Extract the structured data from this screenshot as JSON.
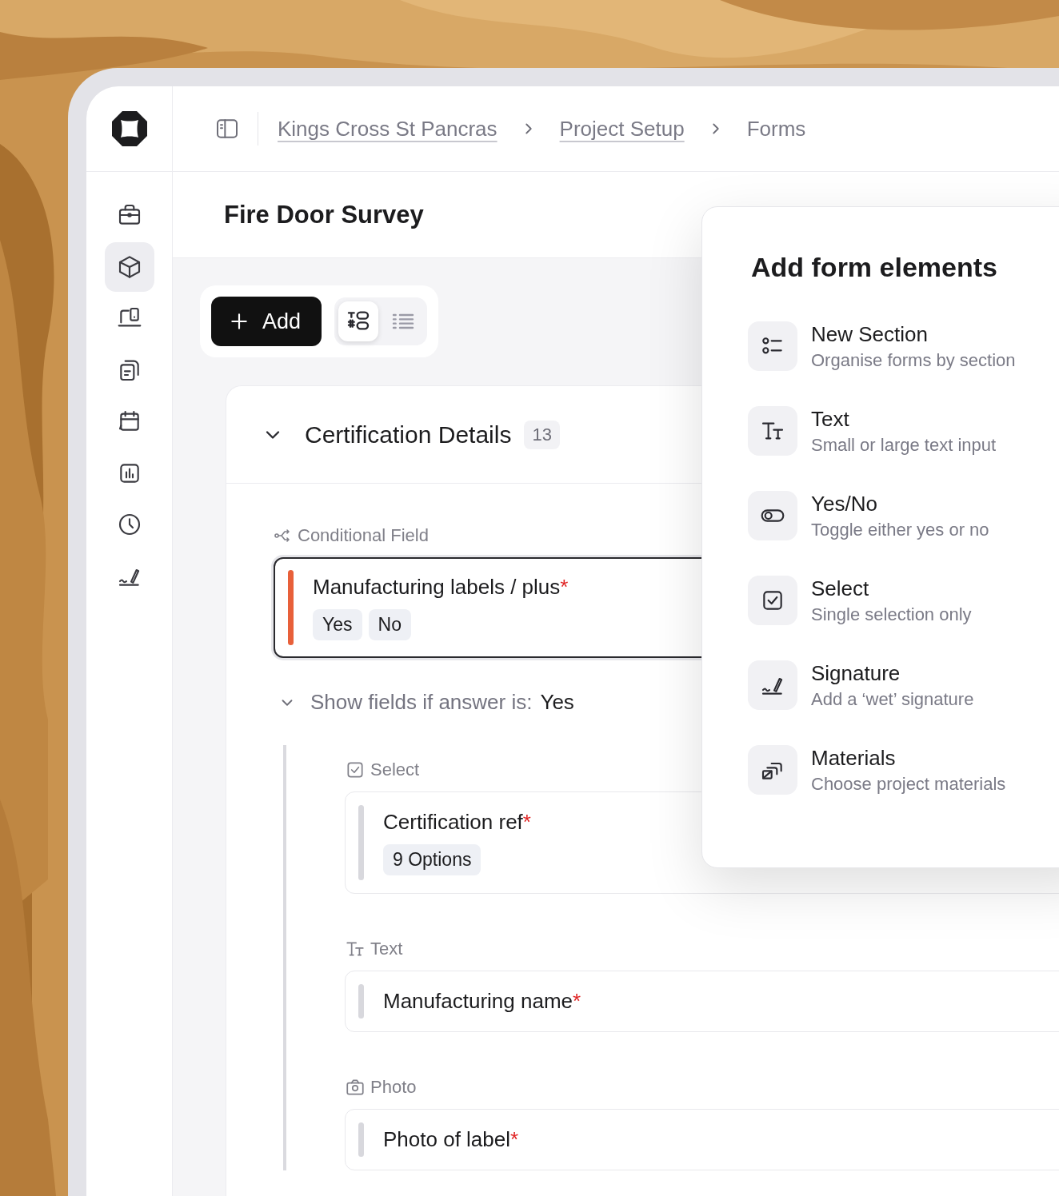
{
  "breadcrumbs": [
    {
      "label": "Kings Cross St Pancras",
      "kind": "link"
    },
    {
      "label": "Project Setup",
      "kind": "link"
    },
    {
      "label": "Forms",
      "kind": "current"
    }
  ],
  "sidebar": {
    "items": [
      {
        "selected": false
      },
      {
        "selected": true
      },
      {
        "selected": false
      },
      {
        "selected": false
      },
      {
        "selected": false
      },
      {
        "selected": false
      },
      {
        "selected": false
      },
      {
        "selected": false
      }
    ]
  },
  "page_title": "Fire Door Survey",
  "toolbar": {
    "add_button": "Add",
    "views": [
      {
        "selected": true
      },
      {
        "selected": false
      }
    ]
  },
  "section": {
    "title": "Certification Details",
    "count": "13",
    "expanded": true,
    "conditional": {
      "label": "Conditional Field",
      "field": {
        "title": "Manufacturing labels / plus",
        "required_mark": "*",
        "active": true,
        "options": [
          "Yes",
          "No"
        ]
      },
      "rule": {
        "label": "Show fields if answer is:",
        "answer": "Yes",
        "expanded": true
      },
      "fields": [
        {
          "kind": "select",
          "type_label": "Select",
          "title": "Certification ref",
          "required_mark": "*",
          "active": false,
          "badge": "9 Options"
        },
        {
          "kind": "text",
          "type_label": "Text",
          "title": "Manufacturing name",
          "required_mark": "*",
          "active": false
        },
        {
          "type_label": "Photo",
          "title": "Photo of label",
          "required_mark": "*",
          "active": false
        }
      ]
    }
  },
  "panel": {
    "title": "Add form elements",
    "items": [
      {
        "title": "New Section",
        "description": "Organise forms by section"
      },
      {
        "title": "Text",
        "description": "Small or large text input"
      },
      {
        "title": "Yes/No",
        "description": "Toggle either yes or no"
      },
      {
        "title": "Select",
        "description": "Single selection only"
      },
      {
        "title": "Signature",
        "description": "Add a ‘wet’ signature"
      },
      {
        "title": "Materials",
        "description": "Choose project materials"
      }
    ]
  }
}
